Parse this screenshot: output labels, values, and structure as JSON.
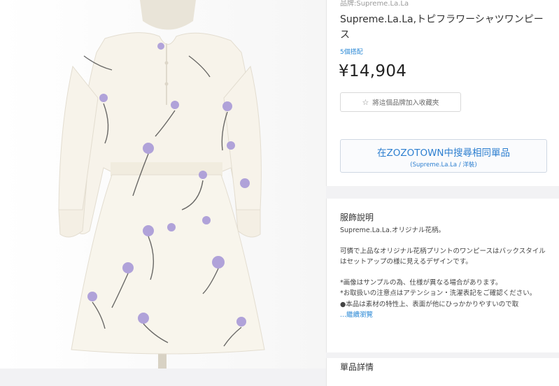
{
  "product": {
    "brand_line": "品牌:Supreme.La.La",
    "title": "Supreme.La.La,トピフラワーシャツワンピース",
    "review_link": "5個搭配",
    "price": "¥14,904",
    "favorite_button": "將這個品牌加入收藏夾",
    "search_button": {
      "main": "在ZOZOTOWN中搜尋相同單品",
      "sub": "(Supreme.La.La / 洋裝)"
    }
  },
  "description": {
    "title": "服飾說明",
    "line1": "Supreme.La.La.オリジナル花柄。",
    "line2": "可憐で上品なオリジナル花柄プリントのワンピースはバックスタイルはセットアップの様に見えるデザインです。",
    "note1": "*画像はサンプルの為、仕様が異なる場合があります。",
    "note2": "*お取扱いの注意点はアテンション・洗濯表記をご確認ください。",
    "note3": "●本品は素材の特性上、表面が他にひっかかりやすいので取",
    "more": "...繼續瀏覽"
  },
  "detail": {
    "title": "單品詳情"
  },
  "icons": {
    "favorite": "star-icon"
  },
  "colors": {
    "accent": "#2d7fd0",
    "flower": "#a99ad8",
    "dress": "#f7f3ea"
  }
}
